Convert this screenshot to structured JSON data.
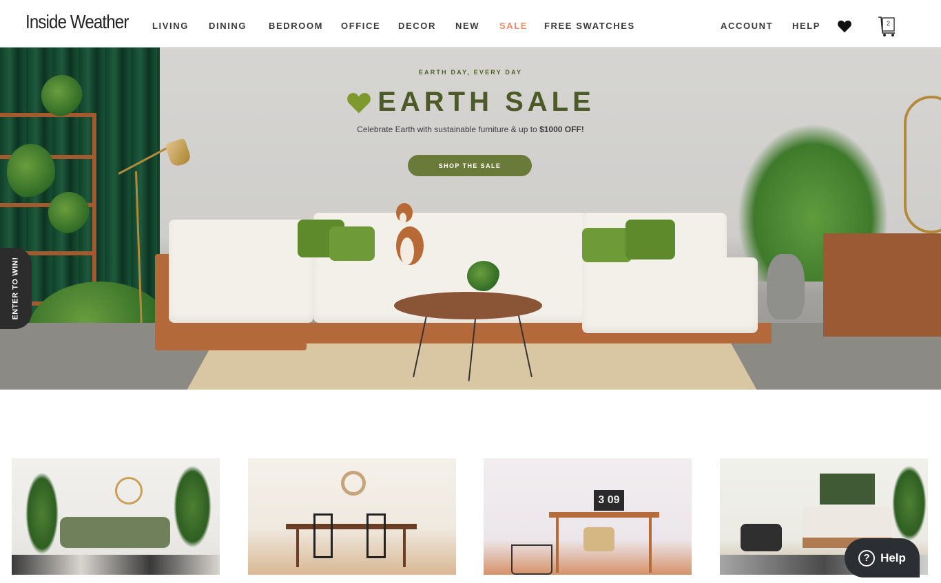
{
  "header": {
    "logo": "Inside Weather",
    "nav": [
      {
        "label": "LIVING"
      },
      {
        "label": "DINING"
      },
      {
        "label": "BEDROOM"
      },
      {
        "label": "OFFICE"
      },
      {
        "label": "DECOR"
      },
      {
        "label": "NEW"
      },
      {
        "label": "SALE"
      },
      {
        "label": "FREE SWATCHES"
      }
    ],
    "account": "ACCOUNT",
    "help": "HELP",
    "cart_count": "2",
    "heart_icon": "heart-icon",
    "cart_icon": "cart-icon"
  },
  "hero": {
    "eyebrow": "EARTH DAY, EVERY DAY",
    "headline": "EARTH SALE",
    "subhead": "Celebrate Earth with sustainable furniture & up to",
    "subhead_bold": "$1000 OFF!",
    "cta": "SHOP THE SALE",
    "colors": {
      "accent": "#4b5a26",
      "button": "#6a7a38",
      "sale_nav": "#f08b6a"
    }
  },
  "enter_to_win": "ENTER TO WIN!",
  "help_widget": {
    "label": "Help",
    "icon": "question-icon"
  }
}
